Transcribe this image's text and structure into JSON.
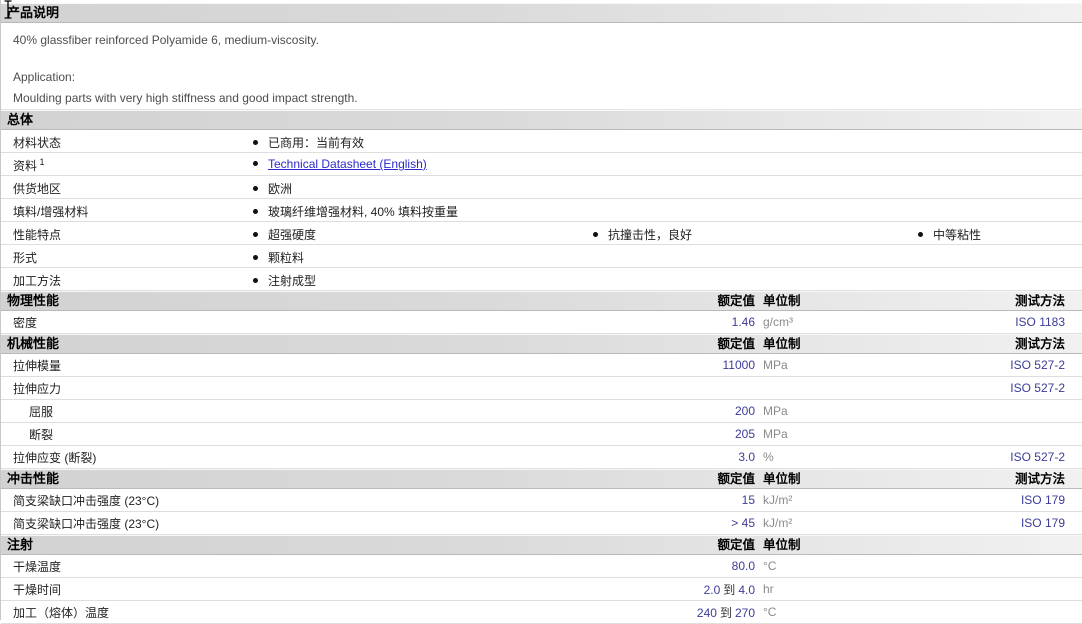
{
  "colors": {
    "value_text": "#3c3c99",
    "unit_text": "#8a8a8a",
    "link_text": "#2b2bcc",
    "section_bar_left": "#d2d2d2",
    "section_bar_right": "#f1f1f1"
  },
  "product": {
    "title": "产品说明",
    "description": "40% glassfiber reinforced Polyamide 6, medium-viscosity.",
    "application_label": "Application:",
    "application_text": "Moulding parts with very high stiffness and good impact strength."
  },
  "general": {
    "title": "总体",
    "rows": [
      {
        "label": "材料状态",
        "items": [
          {
            "text": "已商用：当前有效"
          }
        ]
      },
      {
        "label": "资料",
        "sup": "1",
        "items": [
          {
            "text": "Technical Datasheet (English)",
            "link": true
          }
        ]
      },
      {
        "label": "供货地区",
        "items": [
          {
            "text": "欧洲"
          }
        ]
      },
      {
        "label": "填料/增强材料",
        "items": [
          {
            "text": "玻璃纤维增强材料, 40% 填料按重量"
          }
        ]
      },
      {
        "label": "性能特点",
        "items": [
          {
            "text": "超强硬度"
          },
          {
            "text": "抗撞击性，良好"
          },
          {
            "text": "中等粘性"
          }
        ]
      },
      {
        "label": "形式",
        "items": [
          {
            "text": "颗粒料"
          }
        ]
      },
      {
        "label": "加工方法",
        "items": [
          {
            "text": "注射成型"
          }
        ]
      }
    ]
  },
  "property_sections": [
    {
      "title": "物理性能",
      "col_value": "额定值",
      "col_unit": "单位制",
      "col_test": "测试方法",
      "show_test": true,
      "rows": [
        {
          "label": "密度",
          "value": "1.46",
          "unit": "g/cm³",
          "test": "ISO 1183"
        }
      ]
    },
    {
      "title": "机械性能",
      "col_value": "额定值",
      "col_unit": "单位制",
      "col_test": "测试方法",
      "show_test": true,
      "rows": [
        {
          "label": "拉伸模量",
          "value": "11000",
          "unit": "MPa",
          "test": "ISO 527-2"
        },
        {
          "label": "拉伸应力",
          "value": "",
          "unit": "",
          "test": "ISO 527-2"
        },
        {
          "label": "屈服",
          "indent": true,
          "value": "200",
          "unit": "MPa",
          "test": ""
        },
        {
          "label": "断裂",
          "indent": true,
          "value": "205",
          "unit": "MPa",
          "test": ""
        },
        {
          "label": "拉伸应变  (断裂)",
          "value": "3.0",
          "unit": "%",
          "test": "ISO 527-2"
        }
      ]
    },
    {
      "title": "冲击性能",
      "col_value": "额定值",
      "col_unit": "单位制",
      "col_test": "测试方法",
      "show_test": true,
      "rows": [
        {
          "label": "简支梁缺口冲击强度  (23°C)",
          "value": "15",
          "unit": "kJ/m²",
          "test": "ISO 179"
        },
        {
          "label": "简支梁缺口冲击强度  (23°C)",
          "value": "> 45",
          "unit": "kJ/m²",
          "test": "ISO 179"
        }
      ]
    },
    {
      "title": "注射",
      "col_value": "额定值",
      "col_unit": "单位制",
      "col_test": "",
      "show_test": false,
      "rows": [
        {
          "label": "干燥温度",
          "value": "80.0",
          "unit": "°C"
        },
        {
          "label": "干燥时间",
          "value": "2.0",
          "joiner": "到",
          "value2": "4.0",
          "unit": "hr"
        },
        {
          "label": "加工（熔体）温度",
          "value": "240",
          "joiner": "到",
          "value2": "270",
          "unit": "°C"
        }
      ]
    }
  ],
  "layout": {
    "bullet_column_lefts": [
      252,
      592,
      917
    ]
  }
}
